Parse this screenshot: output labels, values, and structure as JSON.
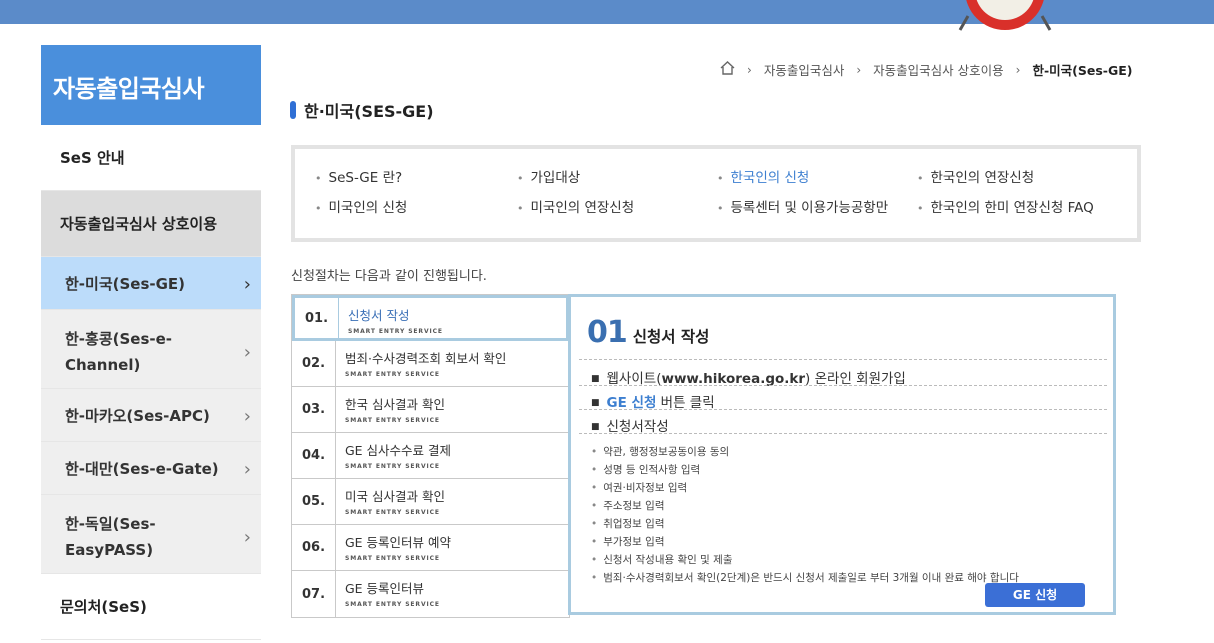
{
  "sidebar": {
    "title": "자동출입국심사",
    "items": [
      {
        "label": "SeS 안내"
      },
      {
        "label": "자동출입국심사 상호이용"
      },
      {
        "label": "한-미국(Ses-GE)"
      },
      {
        "label": "한-홍콩(Ses-e-Channel)"
      },
      {
        "label": "한-마카오(Ses-APC)"
      },
      {
        "label": "한-대만(Ses-e-Gate)"
      },
      {
        "label": "한-독일(Ses-EasyPASS)"
      },
      {
        "label": "문의처(SeS)"
      }
    ]
  },
  "breadcrumb": {
    "items": [
      "자동출입국심사",
      "자동출입국심사 상호이용",
      "한-미국(Ses-GE)"
    ]
  },
  "page_title": "한·미국(SES-GE)",
  "tabs": [
    {
      "label": "SeS-GE 란?"
    },
    {
      "label": "가입대상"
    },
    {
      "label": "한국인의 신청"
    },
    {
      "label": "한국인의 연장신청"
    },
    {
      "label": "미국인의 신청"
    },
    {
      "label": "미국인의 연장신청"
    },
    {
      "label": "등록센터 및 이용가능공항만"
    },
    {
      "label": "한국인의 한미 연장신청 FAQ"
    }
  ],
  "intro": "신청절차는 다음과 같이 진행됩니다.",
  "steps": [
    {
      "num": "01.",
      "label": "신청서 작성",
      "sub": "SMART ENTRY SERVICE"
    },
    {
      "num": "02.",
      "label": "범죄·수사경력조회 회보서 확인",
      "sub": "SMART ENTRY SERVICE"
    },
    {
      "num": "03.",
      "label": "한국 심사결과 확인",
      "sub": "SMART ENTRY SERVICE"
    },
    {
      "num": "04.",
      "label": "GE 심사수수료 결제",
      "sub": "SMART ENTRY SERVICE"
    },
    {
      "num": "05.",
      "label": "미국 심사결과 확인",
      "sub": "SMART ENTRY SERVICE"
    },
    {
      "num": "06.",
      "label": "GE 등록인터뷰 예약",
      "sub": "SMART ENTRY SERVICE"
    },
    {
      "num": "07.",
      "label": "GE 등록인터뷰",
      "sub": "SMART ENTRY SERVICE"
    }
  ],
  "detail": {
    "num": "01",
    "title": "신청서 작성",
    "item1_pre": "웹사이트(",
    "item1_site": "www.hikorea.go.kr",
    "item1_post": ") 온라인 회원가입",
    "item2_hl": "GE 신청",
    "item2_post": " 버튼 클릭",
    "item3": "신청서작성",
    "sublist": [
      "약관, 행정정보공동이용 동의",
      "성명 등 인적사항 입력",
      "여권·비자정보 입력",
      "주소정보 입력",
      "취업정보 입력",
      "부가정보 입력",
      "신청서 작성내용 확인 및 제출",
      "범죄·수사경력회보서 확인(2단계)은 반드시 신청서 제출일로 부터 3개월 이내 완료 해야 합니다"
    ],
    "button": "GE 신청"
  },
  "colors": {
    "topbar": "#5b8bc9",
    "sidebar_title": "#4a8fdc",
    "active_sub": "#bcdcfa",
    "accent": "#3d7fd0",
    "panel_border": "#a9cbe0",
    "button": "#3b6fd6"
  }
}
